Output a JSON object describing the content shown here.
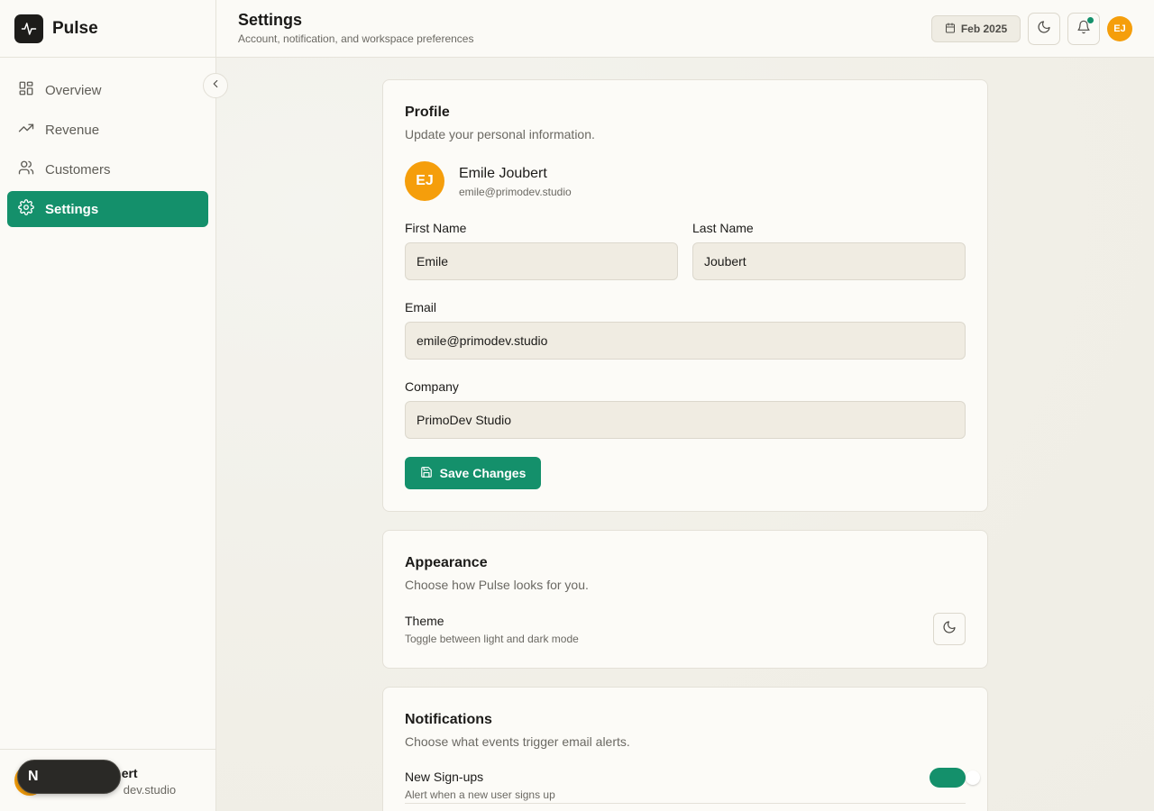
{
  "app": {
    "name": "Pulse"
  },
  "sidebar": {
    "items": [
      {
        "label": "Overview",
        "icon": "grid-icon",
        "active": false
      },
      {
        "label": "Revenue",
        "icon": "trending-up-icon",
        "active": false
      },
      {
        "label": "Customers",
        "icon": "users-icon",
        "active": false
      },
      {
        "label": "Settings",
        "icon": "gear-icon",
        "active": true
      }
    ],
    "footer": {
      "name_visible": "ert",
      "email_visible": "dev.studio"
    }
  },
  "next_badge": {
    "label": "N"
  },
  "header": {
    "title": "Settings",
    "subtitle": "Account, notification, and workspace preferences",
    "date": "Feb 2025",
    "avatar_initials": "EJ"
  },
  "profile": {
    "title": "Profile",
    "description": "Update your personal information.",
    "avatar_initials": "EJ",
    "name": "Emile Joubert",
    "email": "emile@primodev.studio",
    "fields": {
      "first_name_label": "First Name",
      "first_name_value": "Emile",
      "last_name_label": "Last Name",
      "last_name_value": "Joubert",
      "email_label": "Email",
      "email_value": "emile@primodev.studio",
      "company_label": "Company",
      "company_value": "PrimoDev Studio"
    },
    "save_label": "Save Changes"
  },
  "appearance": {
    "title": "Appearance",
    "description": "Choose how Pulse looks for you.",
    "theme_label": "Theme",
    "theme_help": "Toggle between light and dark mode"
  },
  "notifications": {
    "title": "Notifications",
    "description": "Choose what events trigger email alerts.",
    "items": [
      {
        "label": "New Sign-ups",
        "help": "Alert when a new user signs up",
        "enabled": true
      }
    ]
  },
  "colors": {
    "accent": "#14906b",
    "avatar": "#f59e0b"
  }
}
